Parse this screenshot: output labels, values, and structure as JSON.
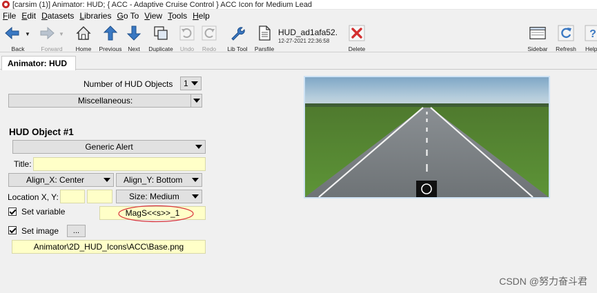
{
  "window": {
    "title": "[carsim (1)] Animator: HUD; { ACC - Adaptive Cruise Control } ACC Icon for Medium Lead"
  },
  "menu": [
    {
      "label": "File",
      "accel": "F",
      "rest": "ile"
    },
    {
      "label": "Edit",
      "accel": "E",
      "rest": "dit"
    },
    {
      "label": "Datasets",
      "accel": "D",
      "rest": "atasets"
    },
    {
      "label": "Libraries",
      "accel": "L",
      "rest": "ibraries"
    },
    {
      "label": "Go To",
      "accel": "G",
      "rest": "o To"
    },
    {
      "label": "View",
      "accel": "V",
      "rest": "iew"
    },
    {
      "label": "Tools",
      "accel": "T",
      "rest": "ools"
    },
    {
      "label": "Help",
      "accel": "H",
      "rest": "elp"
    }
  ],
  "toolbar": {
    "back": "Back",
    "forward": "Forward",
    "home": "Home",
    "previous": "Previous",
    "next": "Next",
    "duplicate": "Duplicate",
    "undo": "Undo",
    "redo": "Redo",
    "lib_tool": "Lib Tool",
    "parsfile": "Parsfile",
    "delete": "Delete",
    "sidebar": "Sidebar",
    "refresh": "Refresh",
    "help": "Help"
  },
  "file_info": {
    "name": "HUD_ad1afa52.",
    "date": "12-27-2021 22:36:58"
  },
  "tab": {
    "label": "Animator: HUD"
  },
  "form": {
    "num_objects_label": "Number of HUD Objects",
    "num_objects_value": "1",
    "misc_dropdown": "Miscellaneous:",
    "object_heading": "HUD Object #1",
    "type_dropdown": "Generic Alert",
    "title_label": "Title:",
    "title_value": "",
    "align_x": "Align_X: Center",
    "align_y": "Align_Y: Bottom",
    "location_label": "Location X, Y:",
    "location_x": "",
    "location_y": "",
    "size_dropdown": "Size: Medium",
    "set_variable_label": "Set variable",
    "set_variable_checked": true,
    "variable_value": "MagS<<s>>_1",
    "set_image_label": "Set image",
    "set_image_checked": true,
    "browse_label": "...",
    "image_path": "Animator\\2D_HUD_Icons\\ACC\\Base.png"
  },
  "watermark": "CSDN @努力奋斗君",
  "colors": {
    "field_yellow": "#ffffc8",
    "annotation_red": "#d9363e",
    "delete_red": "#d32f2f",
    "icon_blue": "#3a78c2",
    "window_bg": "#f0f0f0"
  }
}
